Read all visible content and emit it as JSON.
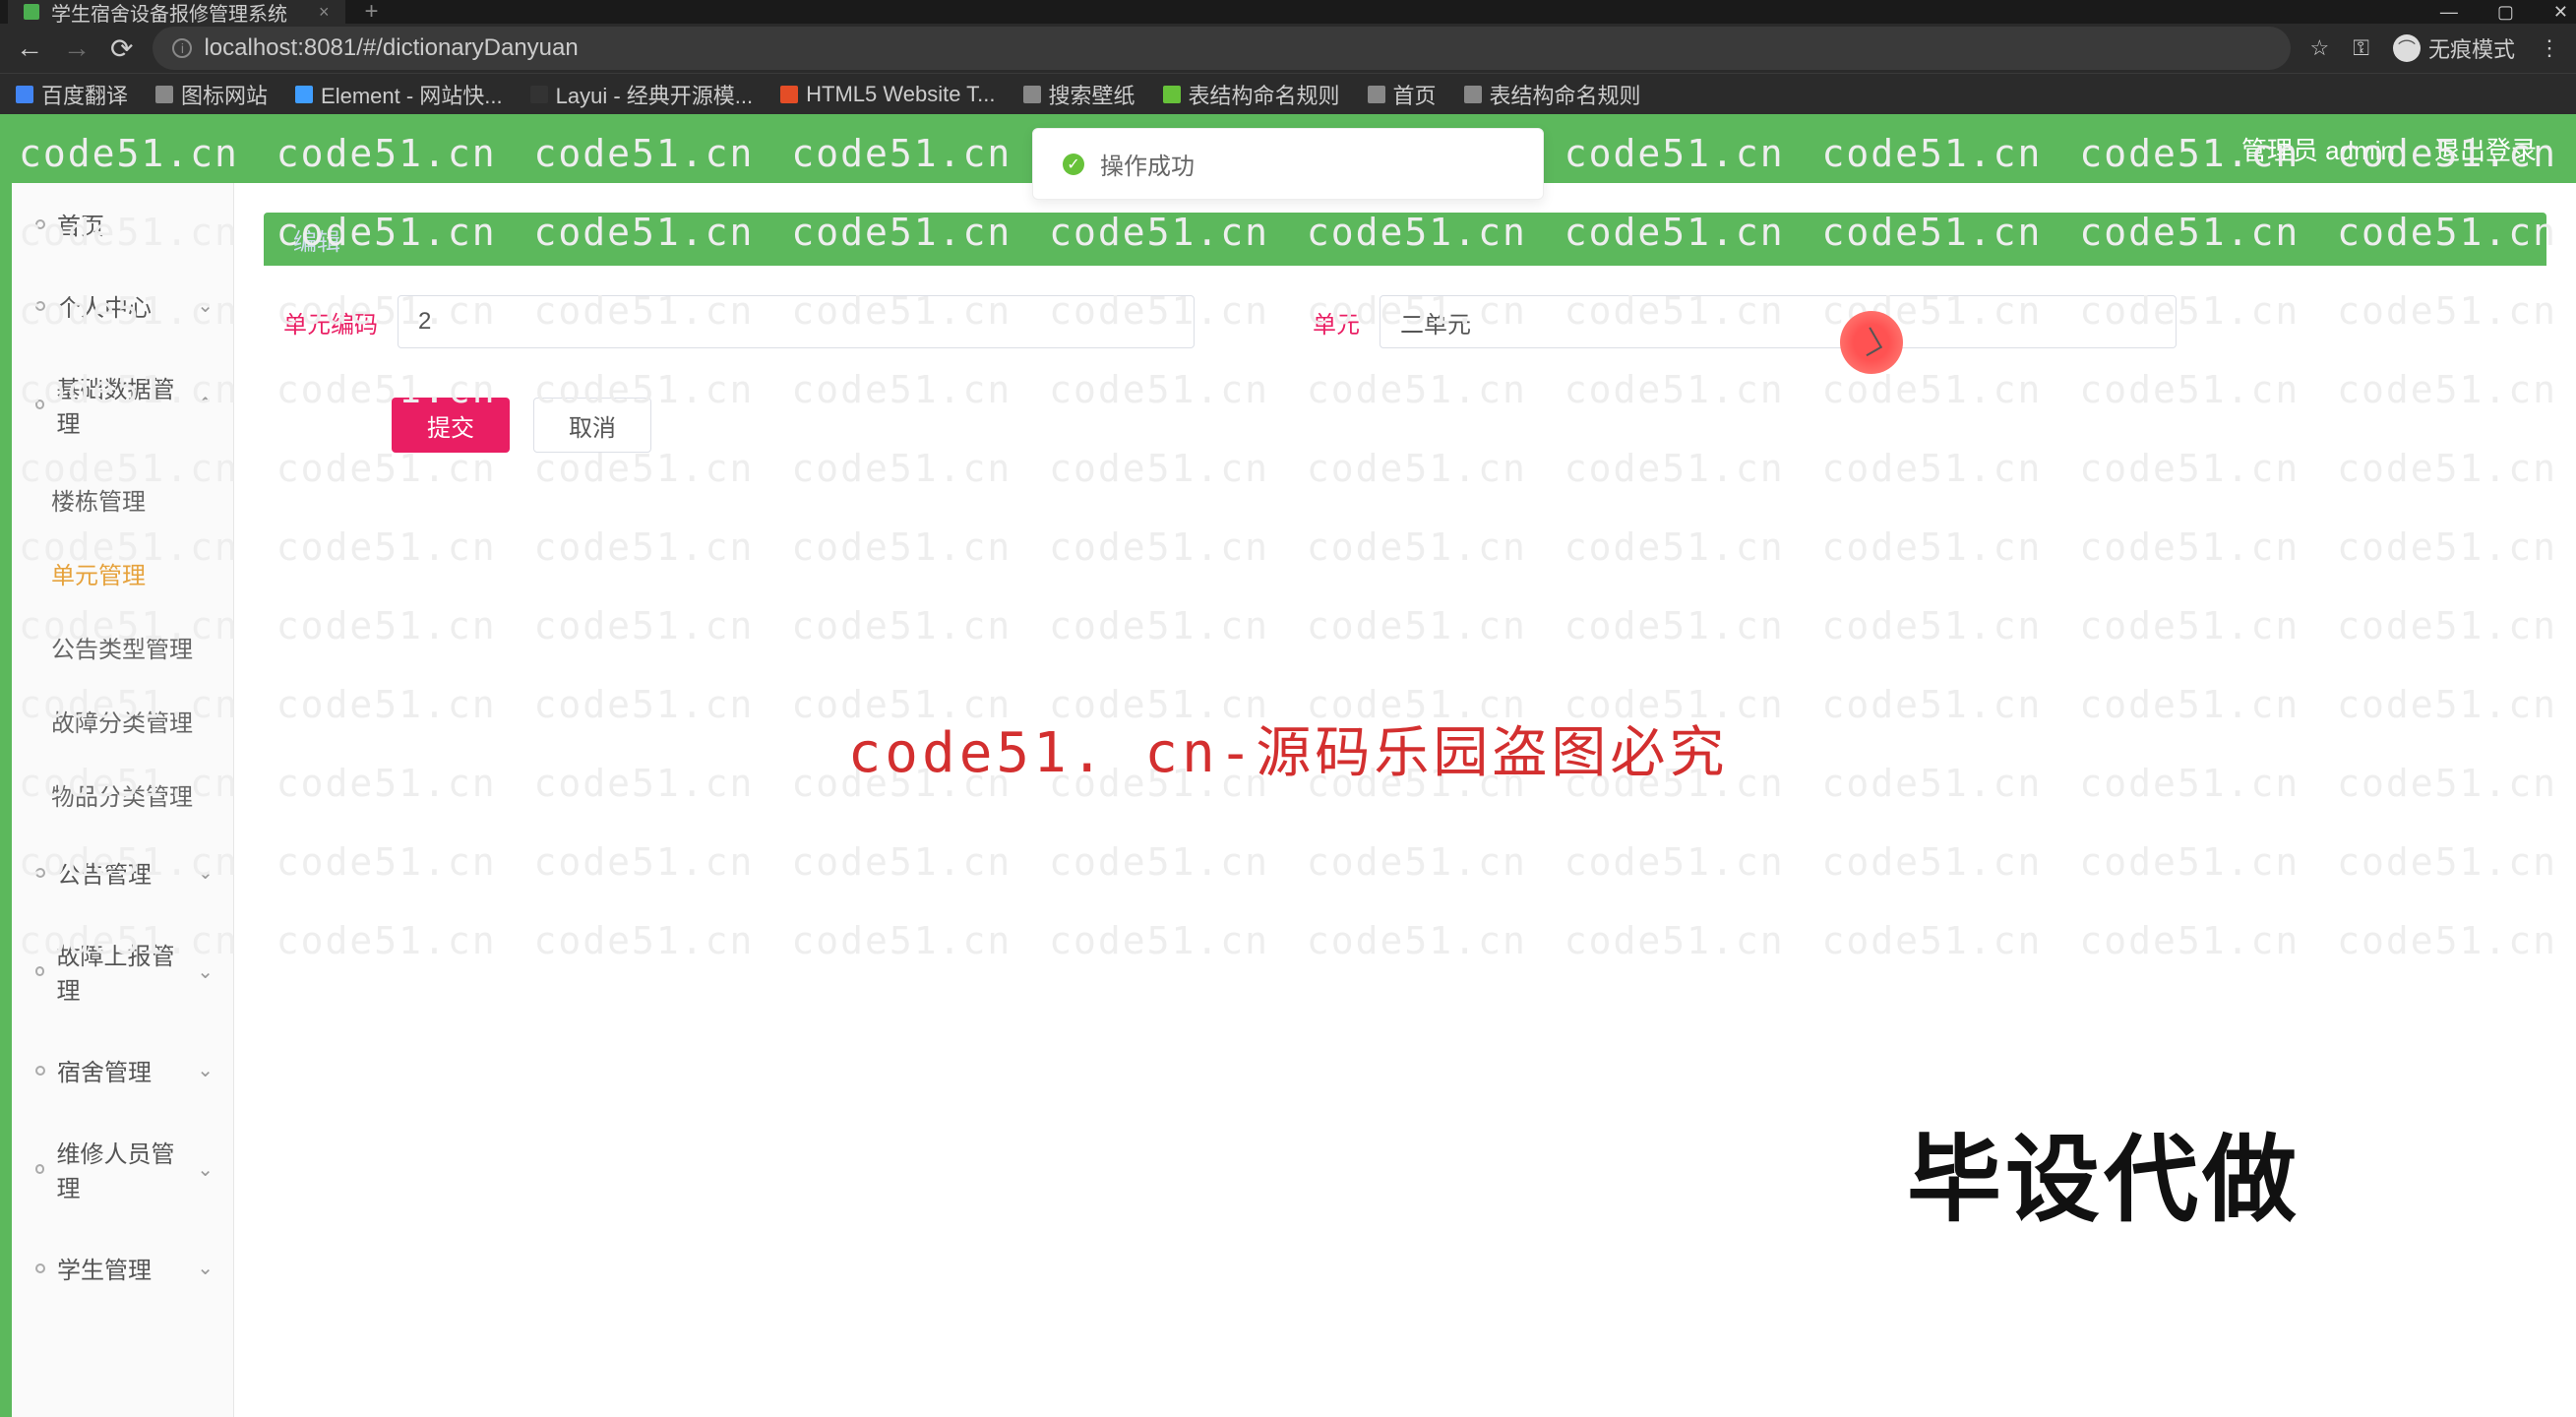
{
  "browser": {
    "tab_title": "学生宿舍设备报修管理系统",
    "url": "localhost:8081/#/dictionaryDanyuan",
    "profile_mode": "无痕模式",
    "bookmarks": [
      {
        "label": "百度翻译",
        "color": "#4285f4"
      },
      {
        "label": "图标网站",
        "color": "#888"
      },
      {
        "label": "Element - 网站快...",
        "color": "#409eff"
      },
      {
        "label": "Layui - 经典开源模...",
        "color": "#333"
      },
      {
        "label": "HTML5 Website T...",
        "color": "#e44d26"
      },
      {
        "label": "搜索壁纸",
        "color": "#888"
      },
      {
        "label": "表结构命名规则",
        "color": "#67c23a"
      },
      {
        "label": "首页",
        "color": "#888"
      },
      {
        "label": "表结构命名规则",
        "color": "#888"
      }
    ]
  },
  "header": {
    "user_label": "管理员 admin",
    "logout": "退出登录"
  },
  "toast_msg": "操作成功",
  "sidebar": {
    "home": "首页",
    "personal": "个人中心",
    "base_data": "基础数据管理",
    "subs": [
      {
        "label": "楼栋管理"
      },
      {
        "label": "单元管理"
      },
      {
        "label": "公告类型管理"
      },
      {
        "label": "故障分类管理"
      },
      {
        "label": "物品分类管理"
      }
    ],
    "other": [
      {
        "label": "公告管理"
      },
      {
        "label": "故障上报管理"
      },
      {
        "label": "宿舍管理"
      },
      {
        "label": "维修人员管理"
      },
      {
        "label": "学生管理"
      }
    ]
  },
  "panel": {
    "crumb": "编辑"
  },
  "form": {
    "code_label": "单元编码",
    "code_value": "2",
    "name_label": "单元",
    "name_value": "二单元",
    "submit": "提交",
    "cancel": "取消"
  },
  "watermark_text": "code51.cn",
  "center_text": "code51. cn-源码乐园盗图必究",
  "corner_text": "毕设代做"
}
